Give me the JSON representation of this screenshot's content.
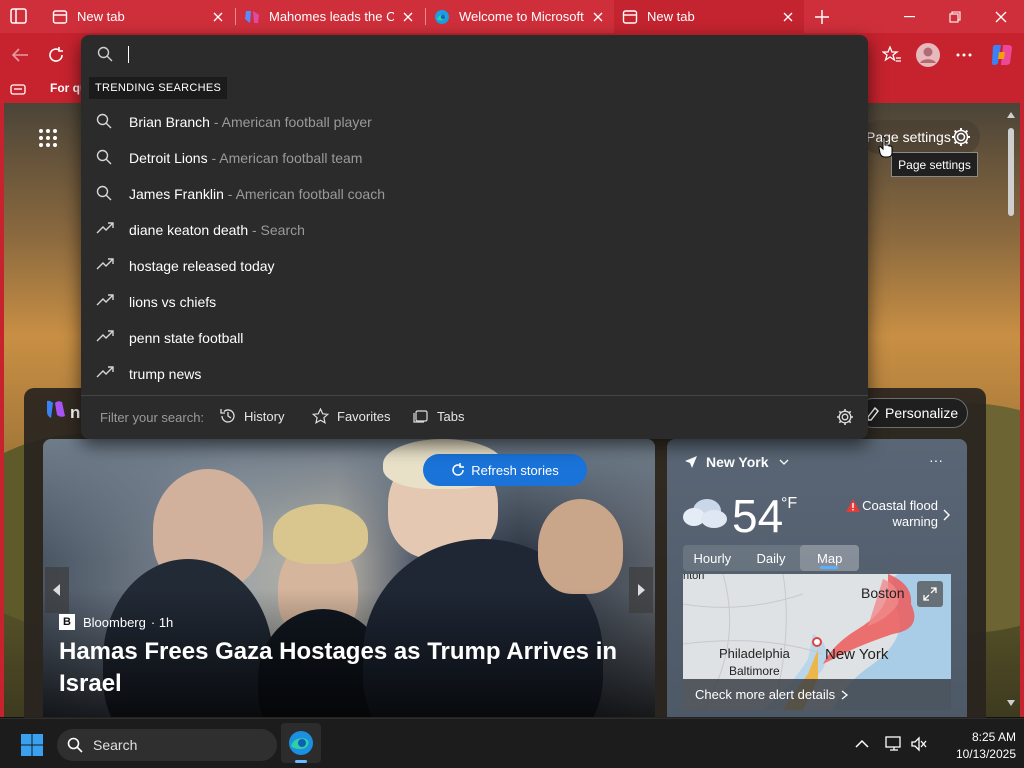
{
  "tabs": [
    {
      "title": "New tab",
      "active": false
    },
    {
      "title": "Mahomes leads the Chie",
      "active": false
    },
    {
      "title": "Welcome to Microsoft E",
      "active": false
    },
    {
      "title": "New tab",
      "active": true
    }
  ],
  "favorites_bar": {
    "item": "For qu"
  },
  "omnibox": {
    "input_value": "",
    "trending_label": "TRENDING SEARCHES",
    "suggestions": [
      {
        "main": "Brian Branch",
        "sub": " - American football player",
        "icon": "search-icon"
      },
      {
        "main": "Detroit Lions",
        "sub": " - American football team",
        "icon": "search-icon"
      },
      {
        "main": "James Franklin",
        "sub": " - American football coach",
        "icon": "search-icon"
      },
      {
        "main": "diane keaton death",
        "sub": " - Search",
        "icon": "trending-icon"
      },
      {
        "main": "hostage released today",
        "sub": "",
        "icon": "trending-icon"
      },
      {
        "main": "lions vs chiefs",
        "sub": "",
        "icon": "trending-icon"
      },
      {
        "main": "penn state football",
        "sub": "",
        "icon": "trending-icon"
      },
      {
        "main": "trump news",
        "sub": "",
        "icon": "trending-icon"
      }
    ],
    "filter": {
      "label": "Filter your search:",
      "history": "History",
      "favorites": "Favorites",
      "tabs": "Tabs"
    }
  },
  "page": {
    "page_settings_label": "Page settings",
    "tooltip": "Page settings",
    "msn_partial": "n",
    "personalize_label": "Personalize",
    "refresh_label": "Refresh stories"
  },
  "hero": {
    "source": "Bloomberg",
    "age": "· 1h",
    "headline": "Hamas Frees Gaza Hostages as Trump Arrives in Israel"
  },
  "weather": {
    "location": "New York",
    "more": "···",
    "temp": "54",
    "unit": "°F",
    "alert": "Coastal flood warning",
    "tabs": [
      "Hourly",
      "Daily",
      "Map"
    ],
    "active_tab": "Map",
    "map_labels": {
      "boston": "Boston",
      "philadelphia": "Philadelphia",
      "baltimore": "Baltimore",
      "new_york": "New York",
      "top": "nton"
    },
    "alert_link": "Check more alert details"
  },
  "taskbar": {
    "search_label": "Search",
    "time": "8:25 AM",
    "date": "10/13/2025"
  },
  "colors": {
    "accent_red": "#cf2f3a",
    "dropdown_bg": "#2b2b2b",
    "refresh_blue": "#1a73d9"
  }
}
